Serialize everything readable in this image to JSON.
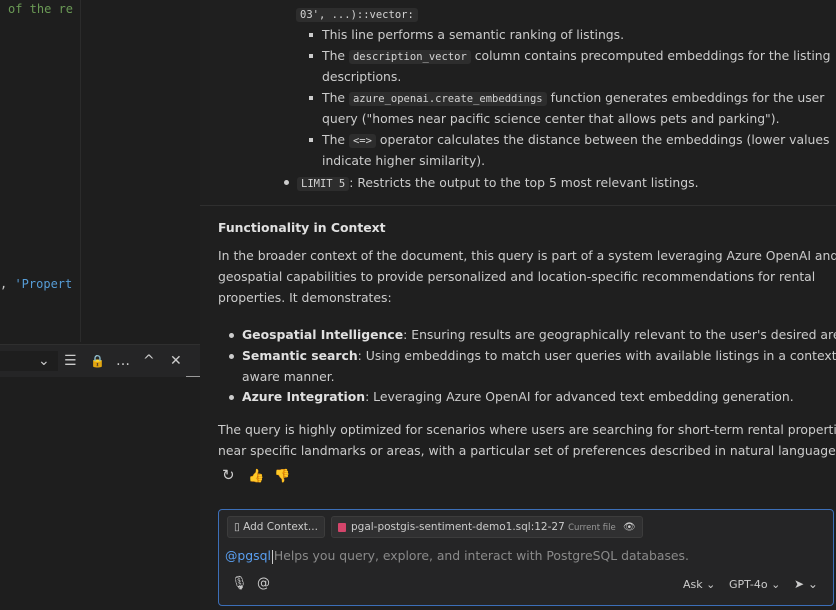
{
  "editor": {
    "code_top": "of the re",
    "code_prop_prefix": ", ",
    "code_prop_string": "'Propert",
    "find_bar": {
      "chevron": "⌄",
      "lines_icon": "☰",
      "lock_icon": "🔒",
      "more_icon": "…",
      "up_icon": "^",
      "close_icon": "✕"
    }
  },
  "chat": {
    "code_line_top": "03', ...)::vector:",
    "sub_bullets": [
      {
        "text": "This line performs a semantic ranking of listings."
      },
      {
        "pre": "The ",
        "code": "description_vector",
        "post": " column contains precomputed embeddings for the listing"
      },
      {
        "text": "descriptions."
      },
      {
        "pre": "The ",
        "code": "azure_openai.create_embeddings",
        "post": " function generates embeddings for the user"
      },
      {
        "text": "query (\"homes near pacific science center that allows pets and parking\")."
      },
      {
        "pre": "The ",
        "code": "<=>",
        "post": " operator calculates the distance between the embeddings (lower values"
      },
      {
        "text": "indicate higher similarity)."
      }
    ],
    "limit_bullet": {
      "code": "LIMIT 5",
      "post": ": Restricts the output to the top 5 most relevant listings."
    },
    "section_heading": "Functionality in Context",
    "paragraph1": [
      "In the broader context of the document, this query is part of a system leveraging Azure OpenAI and",
      "geospatial capabilities to provide personalized and location-specific recommendations for rental",
      "properties. It demonstrates:"
    ],
    "features": [
      {
        "bold": "Geospatial Intelligence",
        "text": ": Ensuring results are geographically relevant to the user's desired area."
      },
      {
        "bold": "Semantic search",
        "text": ": Using embeddings to match user queries with available listings in a context-"
      },
      {
        "bold": "",
        "text": "aware manner."
      },
      {
        "bold": "Azure Integration",
        "text": ": Leveraging Azure OpenAI for advanced text embedding generation."
      }
    ],
    "paragraph2": [
      "The query is highly optimized for scenarios where users are searching for short-term rental properties",
      "near specific landmarks or areas, with a particular set of preferences described in natural language."
    ],
    "feedback": {
      "retry_icon": "↻",
      "like_icon": "👍",
      "dislike_icon": "👎"
    },
    "input": {
      "add_context_label": "Add Context...",
      "file_chip_name": "pgal-postgis-sentiment-demo1.sql",
      "file_chip_range": ":12-27",
      "file_chip_tag": "Current file",
      "eye_icon": "👁",
      "agent": "@pgsql",
      "placeholder": "Helps you query, explore, and interact with PostgreSQL databases.",
      "mic_icon": "🎙",
      "at_icon": "@",
      "mode_label": "Ask",
      "model_label": "GPT-4o",
      "send_icon": "➤"
    }
  }
}
